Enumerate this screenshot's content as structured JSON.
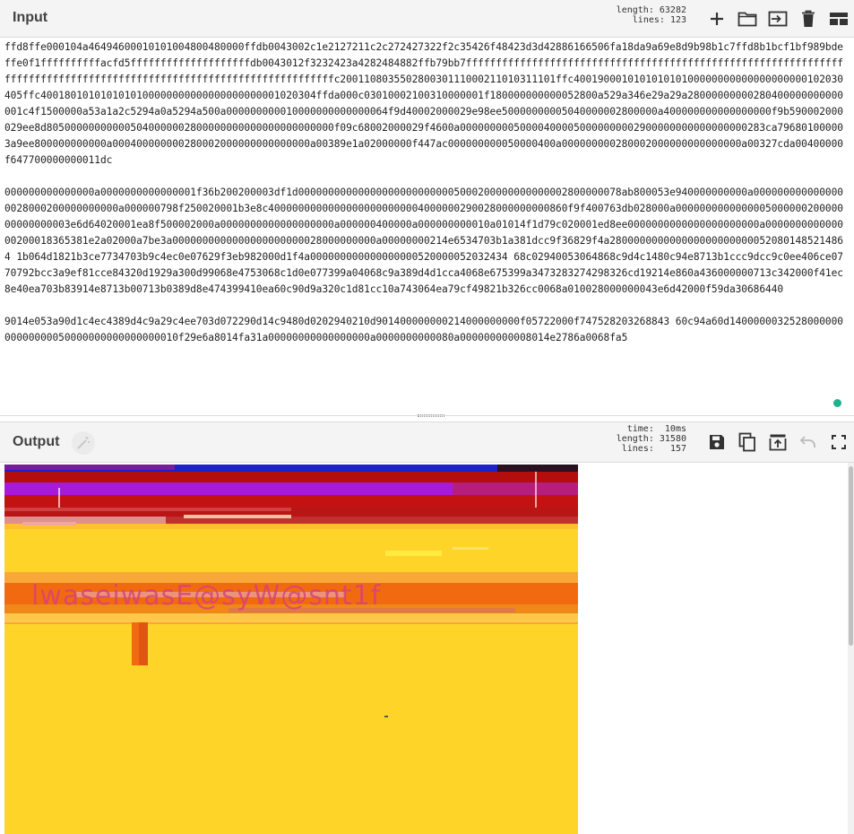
{
  "input": {
    "title": "Input",
    "stats": {
      "length_label": "length:",
      "length_value": "63282",
      "lines_label": "lines:",
      "lines_value": "123"
    },
    "buttons": {
      "add": "add-icon",
      "open_folder": "folder-icon",
      "import": "import-icon",
      "clear": "trash-icon",
      "layout": "layout-icon"
    },
    "content": "ffd8ffe000104a46494600010101004800480000ffdb0043002c1e2127211c2c272427322f2c35426f48423d3d42886166506fa18da9a69e8d9b98b1c7ffd8b1bcf1bf989bdeffe0f1ffffffffffacfd5ffffffffffffffffffffdb0043012f3232423a4282484882ffb79bb7ffffffffffffffffffffffffffffffffffffffffffffffffffffffffffffffffffffffffffffffffffffffffffffffffffffffffffffffffffffffc200110803550280030111000211010311101ffc400190001010101010100000000000000000000102030405ffc4001801010101010100000000000000000000001020304ffda000c03010002100310000001f180000000000052800a529a346e29a29a28000000000280400000000000001c4f1500000a53a1a2c5294a0a5294a500a000000000010000000000000064f9d40002000029e98ee50000000005040000002800000a400000000000000000f9b590002000029ee8d805000000000005040000002800000000000000000000000f09c68002000029f4600a000000000500004000050000000002900000000000000000283ca796801000003a9ee800000000000a000400000000280002000000000000000a00389e1a02000000f447ac000000000050000400a000000000280002000000000000000a00327cda00400000f647700000000011dc\n\n000000000000000a0000000000000001f36b200200003df1d000000000000000000000000005000200000000000002800000078ab800053e940000000000a0000000000000000028000200000000000a000000798f250020001b3e8c40000000000000000000000004000000290028000000000860f9f400763db028000a000000000000000500000020000000000000003e6d64020001ea8f500002000a0000000000000000000a000000400000a000000000010a01014f1d79c020001ed8ee0000000000000000000000a000000000000000200018365381e2a02000a7be3a0000000000000000000000028000000000a00000000214e6534703b1a381dcc9f36829f4a2800000000000000000000000520801485214864 1b064d1821b3ce7734703b9c4ec0e07629f3eb982000d1f4a000000000000000000520000052032434 68c02940053064868c9d4c1480c94e8713b1ccc9dcc9c0ee406ce0770792bcc3a9ef81cce84320d1929a300d99068e4753068c1d0e077399a04068c9a389d4d1cca4068e675399a3473283274298326cd19214e860a436000000713c342000f41ec8e40ea703b83914e8713b00713b0389d8e474399410ea60c90d9a320c1d81cc10a743064ea79cf49821b326cc0068a010028000000043e6d42000f59da30686440\n\n9014e053a90d1c4ec4389d4c9a29c4ee703d072290d14c9480d0202940210d901400000000214000000000f05722000f747528203268843 60c94a60d140000003252800000000000000050000000000000000010f29e6a8014fa31a00000000000000000a0000000000080a000000000008014e2786a0068fa5"
  },
  "output": {
    "title": "Output",
    "magic": "magic-wand-icon",
    "stats": {
      "time_label": "time:",
      "time_value": "10ms",
      "length_label": "length:",
      "length_value": "31580",
      "lines_label": "lines:",
      "lines_value": "157"
    },
    "buttons": {
      "save": "save-icon",
      "copy": "copy-icon",
      "replace_input": "replace-input-icon",
      "undo": "undo-icon",
      "maximise": "maximise-icon"
    },
    "image": {
      "description_colors": {
        "background": "#ffd428",
        "red_band": "#b30d0d",
        "purple_band": "#a61bd6",
        "blue_top": "#1a22c8",
        "orange": "#f26a10",
        "pink": "#e8a6a6"
      },
      "garbled_text": "lwaseiwasE@syW@snt1f"
    }
  }
}
